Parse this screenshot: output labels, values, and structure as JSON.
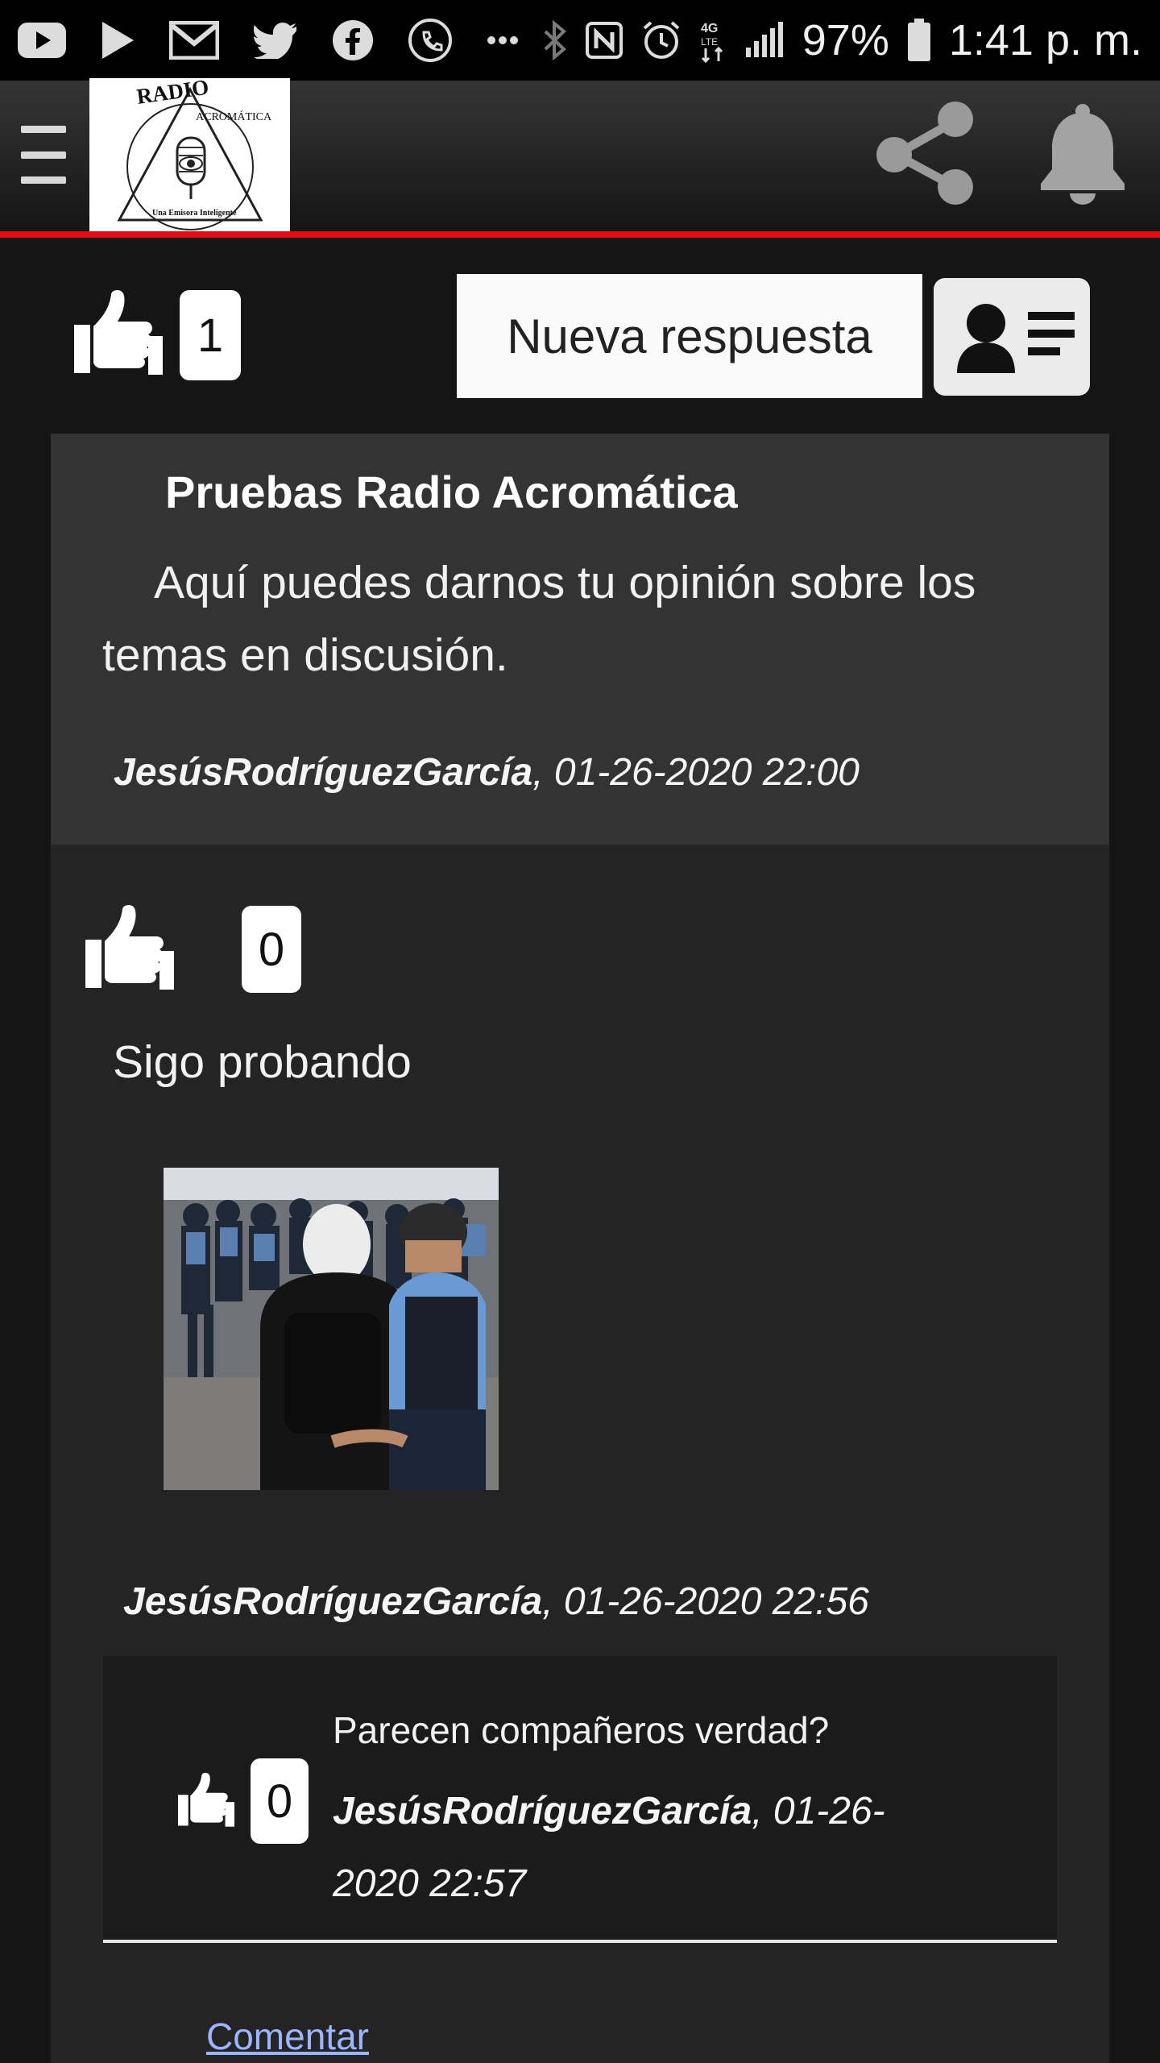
{
  "status_bar": {
    "battery": "97%",
    "time": "1:41 p. m.",
    "network": "4G LTE",
    "icons": [
      "youtube-icon",
      "play-store-icon",
      "gmail-icon",
      "twitter-icon",
      "facebook-icon",
      "phone-app-icon",
      "more-icon",
      "bluetooth-icon",
      "nfc-icon",
      "alarm-icon",
      "signal-icon",
      "battery-icon"
    ]
  },
  "header": {
    "logo_text_top": "RADIO",
    "logo_text_mid": "ACROMÁTICA",
    "logo_text_bottom": "Una Emisora Inteligente",
    "icons": [
      "menu-icon",
      "share-icon",
      "bell-icon"
    ],
    "accent_color": "#e30d12"
  },
  "actions": {
    "like_count": "1",
    "new_reply_label": "Nueva respuesta",
    "profile_icon": "profile-card-icon"
  },
  "topic": {
    "title": "Pruebas Radio Acromática",
    "body": "Aquí puedes darnos tu opinión sobre los temas en discusión.",
    "author": "JesúsRodríguezGarcía",
    "datetime": ", 01-26-2020 22:00"
  },
  "reply": {
    "like_count": "0",
    "text": "Sigo probando",
    "author": "JesúsRodríguezGarcía",
    "datetime": ", 01-26-2020 22:56",
    "comment": {
      "like_count": "0",
      "text": "Parecen compañeros verdad?",
      "author": "JesúsRodríguezGarcía",
      "datetime": ", 01-26-2020 22:57"
    },
    "comment_link": "Comentar"
  }
}
